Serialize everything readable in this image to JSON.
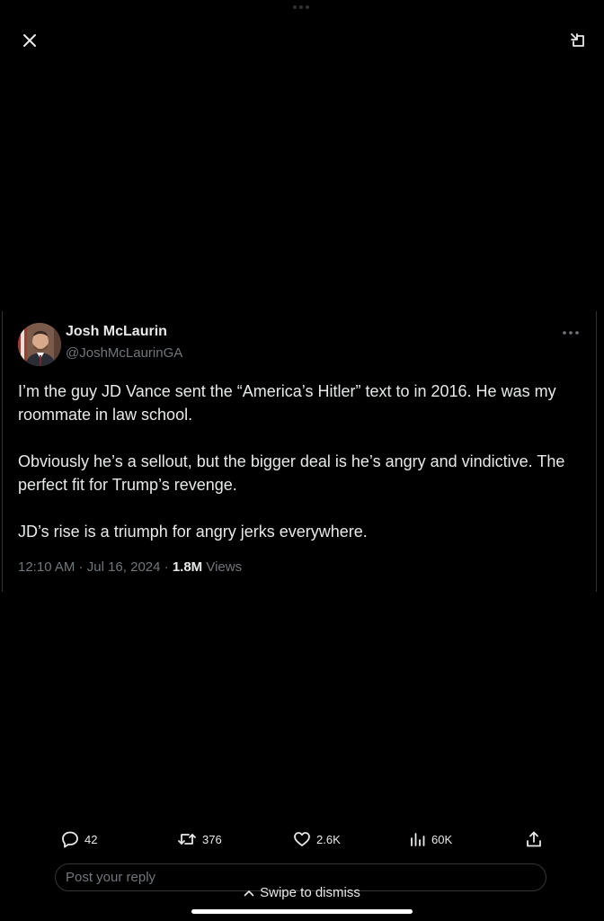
{
  "icons": {
    "close": "close-icon",
    "expand": "expand-icon",
    "more": "more-icon",
    "reply": "reply-icon",
    "retweet": "retweet-icon",
    "like": "heart-icon",
    "views": "views-icon",
    "share": "share-icon",
    "swipe": "chevron-up-icon"
  },
  "tweet": {
    "author_name": "Josh McLaurin",
    "author_handle": "@JoshMcLaurinGA",
    "paragraphs": [
      "I’m the guy JD Vance sent the “America’s Hitler” text to in 2016. He was my roommate in law school.",
      "Obviously he’s a sellout, but the bigger deal is he’s angry and vindictive. The perfect fit for Trump’s revenge.",
      "JD’s rise is a triumph for angry jerks everywhere."
    ],
    "time": "12:10 AM",
    "date": "Jul 16, 2024",
    "separator": "·",
    "views_count": "1.8M",
    "views_label": "Views"
  },
  "actions": {
    "replies": "42",
    "retweets": "376",
    "likes": "2.6K",
    "views": "60K"
  },
  "reply": {
    "placeholder": "Post your reply"
  },
  "swipe_hint": "Swipe to dismiss",
  "colors": {
    "background": "#000000",
    "text": "#e7e9ea",
    "secondary": "#71767b",
    "border": "#2f3336"
  }
}
